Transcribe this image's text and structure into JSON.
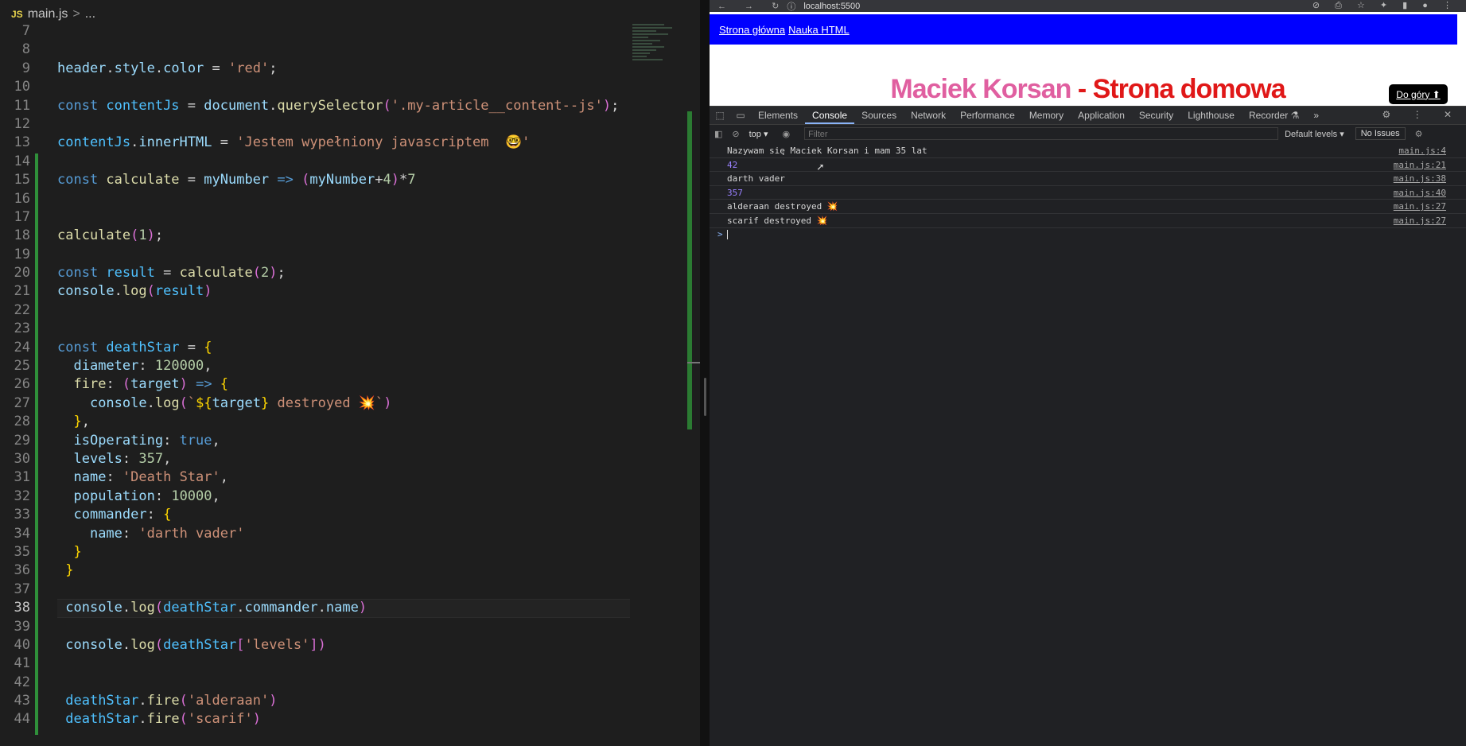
{
  "editor": {
    "file_icon": "JS",
    "file_name": "main.js",
    "breadcrumb_sep": ">",
    "breadcrumb_more": "...",
    "line_numbers": [
      "7",
      "8",
      "9",
      "10",
      "11",
      "12",
      "13",
      "14",
      "15",
      "16",
      "17",
      "18",
      "19",
      "20",
      "21",
      "22",
      "23",
      "24",
      "25",
      "26",
      "27",
      "28",
      "29",
      "30",
      "31",
      "32",
      "33",
      "34",
      "35",
      "36",
      "37",
      "38",
      "39",
      "40",
      "41",
      "42",
      "43",
      "44"
    ],
    "current_line": "38",
    "code": {
      "l9": [
        "header",
        ".",
        "style",
        ".",
        "color",
        " = ",
        "'red'",
        ";"
      ],
      "l11": [
        "const ",
        "contentJs",
        " = ",
        "document",
        ".",
        "querySelector",
        "(",
        "'.my-article__content--js'",
        ")",
        ";"
      ],
      "l13": [
        "contentJs",
        ".",
        "innerHTML",
        " = ",
        "'Jestem wypełniony javascriptem  🤓'"
      ],
      "l15": [
        "const ",
        "calculate",
        " = ",
        "myNumber",
        " => ",
        "(",
        "myNumber",
        "+",
        "4",
        ")",
        "*",
        "7"
      ],
      "l18": [
        "calculate",
        "(",
        "1",
        ")",
        ";"
      ],
      "l20": [
        "const ",
        "result",
        " = ",
        "calculate",
        "(",
        "2",
        ")",
        ";"
      ],
      "l21": [
        "console",
        ".",
        "log",
        "(",
        "result",
        ")"
      ],
      "l24": [
        "const ",
        "deathStar",
        " = ",
        "{"
      ],
      "l25": [
        "  ",
        "diameter",
        ": ",
        "120000",
        ","
      ],
      "l26": [
        "  ",
        "fire",
        ": ",
        "(",
        "target",
        ")",
        " => ",
        "{"
      ],
      "l27": [
        "    ",
        "console",
        ".",
        "log",
        "(",
        "`",
        "${",
        "target",
        "}",
        " destroyed 💥",
        "`",
        ")"
      ],
      "l28": [
        "  ",
        "}",
        ","
      ],
      "l29": [
        "  ",
        "isOperating",
        ": ",
        "true",
        ","
      ],
      "l30": [
        "  ",
        "levels",
        ": ",
        "357",
        ","
      ],
      "l31": [
        "  ",
        "name",
        ": ",
        "'Death Star'",
        ","
      ],
      "l32": [
        "  ",
        "population",
        ": ",
        "10000",
        ","
      ],
      "l33": [
        "  ",
        "commander",
        ": ",
        "{"
      ],
      "l34": [
        "    ",
        "name",
        ": ",
        "'darth vader'"
      ],
      "l35": [
        "  ",
        "}"
      ],
      "l36": [
        " ",
        "}"
      ],
      "l38": [
        " ",
        "console",
        ".",
        "log",
        "(",
        "deathStar",
        ".",
        "commander",
        ".",
        "name",
        ")"
      ],
      "l40": [
        " ",
        "console",
        ".",
        "log",
        "(",
        "deathStar",
        "[",
        "'levels'",
        "]",
        ")"
      ],
      "l43": [
        " ",
        "deathStar",
        ".",
        "fire",
        "(",
        "'alderaan'",
        ")"
      ],
      "l44": [
        " ",
        "deathStar",
        ".",
        "fire",
        "(",
        "'scarif'",
        ")"
      ]
    }
  },
  "browser": {
    "nav_icons": "← → ↻",
    "url": "localhost:5500",
    "toolbar_icons": "⊘ ⎙ ☆ ✦ ▮ ● ⋮",
    "page": {
      "nav_links": [
        "Strona główna",
        "Nauka HTML"
      ],
      "title_name": "Maciek Korsan",
      "title_rest": " - Strona domowa",
      "to_top": "Do góry ⬆"
    },
    "devtools": {
      "tabs": [
        "Elements",
        "Console",
        "Sources",
        "Network",
        "Performance",
        "Memory",
        "Application",
        "Security",
        "Lighthouse",
        "Recorder ⚗"
      ],
      "more": "»",
      "right_icons": "⚙ ⋮ ✕",
      "context": "top ▾",
      "filter_placeholder": "Filter",
      "levels": "Default levels ▾",
      "issues": "No Issues",
      "logs": [
        {
          "text": "Nazywam się Maciek Korsan i mam 35 lat",
          "src": "main.js:4",
          "numeric": false
        },
        {
          "text": "42",
          "src": "main.js:21",
          "numeric": true
        },
        {
          "text": "darth vader",
          "src": "main.js:38",
          "numeric": false
        },
        {
          "text": "357",
          "src": "main.js:40",
          "numeric": true
        },
        {
          "text": "alderaan destroyed 💥",
          "src": "main.js:27",
          "numeric": false
        },
        {
          "text": "scarif destroyed 💥",
          "src": "main.js:27",
          "numeric": false
        }
      ],
      "prompt": ">"
    }
  },
  "colors": {
    "accent": "#8ab4f8",
    "nav_bg": "#0000ff",
    "title_pink": "#e05fa0",
    "title_red": "#e01818",
    "git_added": "#2f8f3a"
  }
}
